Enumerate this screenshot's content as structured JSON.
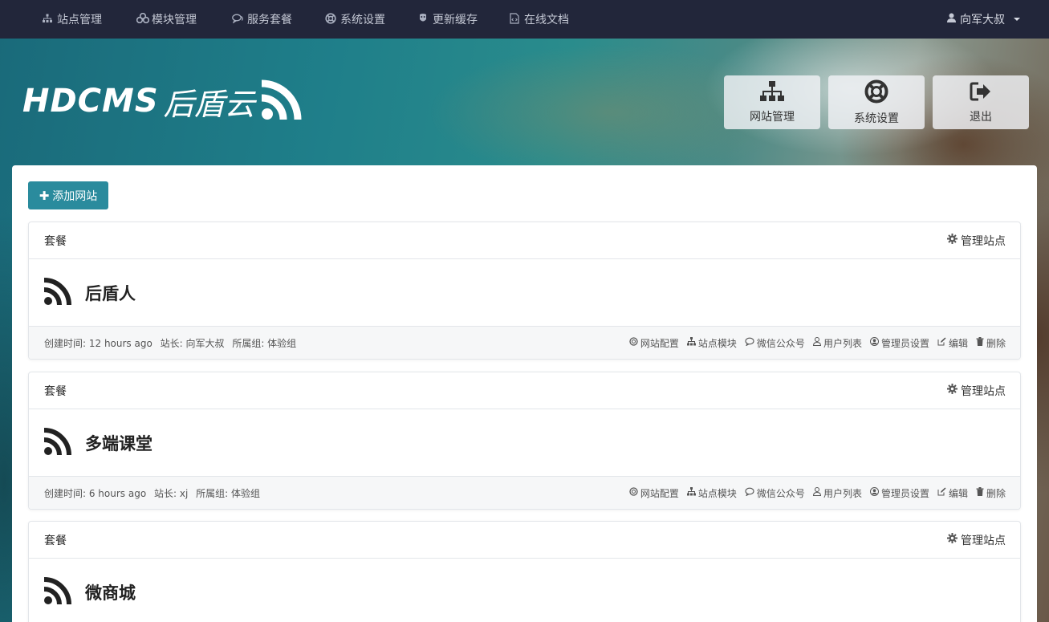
{
  "nav": {
    "items": [
      {
        "label": "站点管理",
        "icon": "sitemap-icon"
      },
      {
        "label": "模块管理",
        "icon": "cubes-icon"
      },
      {
        "label": "服务套餐",
        "icon": "comments-icon"
      },
      {
        "label": "系统设置",
        "icon": "lifering-icon"
      },
      {
        "label": "更新缓存",
        "icon": "cache-icon"
      },
      {
        "label": "在线文档",
        "icon": "doc-icon"
      }
    ],
    "user": "向军大叔"
  },
  "hero": {
    "logo_latin": "HDCMS",
    "logo_cn": "后盾云",
    "buttons": [
      {
        "label": "网站管理",
        "icon": "sitemap-icon"
      },
      {
        "label": "系统设置",
        "icon": "lifering-icon"
      },
      {
        "label": "退出",
        "icon": "sign-out-icon"
      }
    ]
  },
  "main": {
    "add_button": "添加网站",
    "sites": [
      {
        "package": "套餐",
        "manage": "管理站点",
        "name": "后盾人",
        "created": "创建时间: 12 hours ago",
        "owner": "站长: 向军大叔",
        "group": "所属组: 体验组"
      },
      {
        "package": "套餐",
        "manage": "管理站点",
        "name": "多端课堂",
        "created": "创建时间: 6 hours ago",
        "owner": "站长: xj",
        "group": "所属组: 体验组"
      },
      {
        "package": "套餐",
        "manage": "管理站点",
        "name": "微商城"
      }
    ],
    "actions": [
      "网站配置",
      "站点模块",
      "微信公众号",
      "用户列表",
      "管理员设置",
      "编辑",
      "删除"
    ]
  },
  "colors": {
    "nav_bg": "#22263a",
    "accent": "#2a8b9d"
  }
}
